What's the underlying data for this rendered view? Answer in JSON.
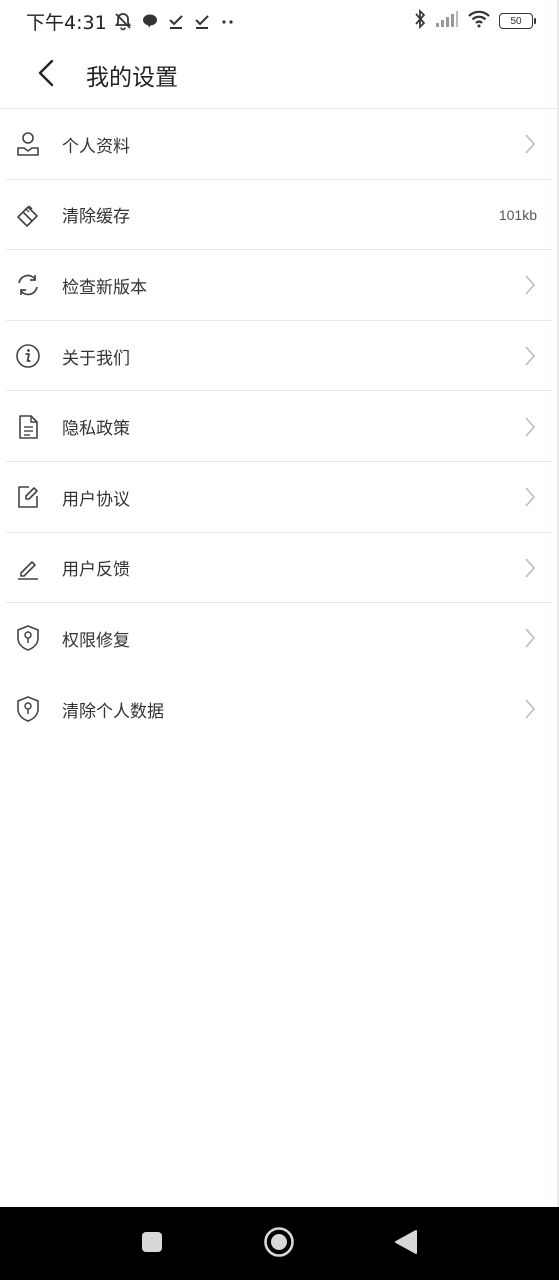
{
  "status_bar": {
    "time": "下午4:31",
    "battery_level": "50",
    "icons": [
      "mute-bell-icon",
      "chat-bubble-icon",
      "download-done-icon",
      "download-done-icon",
      "more-dots-icon",
      "bluetooth-icon",
      "signal-icon",
      "wifi-icon",
      "battery-icon"
    ]
  },
  "header": {
    "title": "我的设置",
    "back_icon": "chevron-left-icon"
  },
  "settings": {
    "items": [
      {
        "label": "个人资料",
        "icon": "user-profile-icon",
        "trailing": "chevron"
      },
      {
        "label": "清除缓存",
        "icon": "eraser-icon",
        "trailing": "value",
        "value": "101kb"
      },
      {
        "label": "检查新版本",
        "icon": "refresh-icon",
        "trailing": "chevron"
      },
      {
        "label": "关于我们",
        "icon": "info-icon",
        "trailing": "chevron"
      },
      {
        "label": "隐私政策",
        "icon": "document-icon",
        "trailing": "chevron"
      },
      {
        "label": "用户协议",
        "icon": "edit-document-icon",
        "trailing": "chevron"
      },
      {
        "label": "用户反馈",
        "icon": "pen-icon",
        "trailing": "chevron"
      },
      {
        "label": "权限修复",
        "icon": "shield-key-icon",
        "trailing": "chevron"
      },
      {
        "label": "清除个人数据",
        "icon": "shield-key-icon",
        "trailing": "chevron"
      }
    ]
  },
  "nav_bar": {
    "buttons": [
      "recents-square-icon",
      "home-circle-icon",
      "back-triangle-icon"
    ]
  },
  "colors": {
    "text": "#333333",
    "icon": "#444444",
    "chevron": "#bdbdbd",
    "divider": "#e6e6e6",
    "nav_background": "#000000"
  }
}
